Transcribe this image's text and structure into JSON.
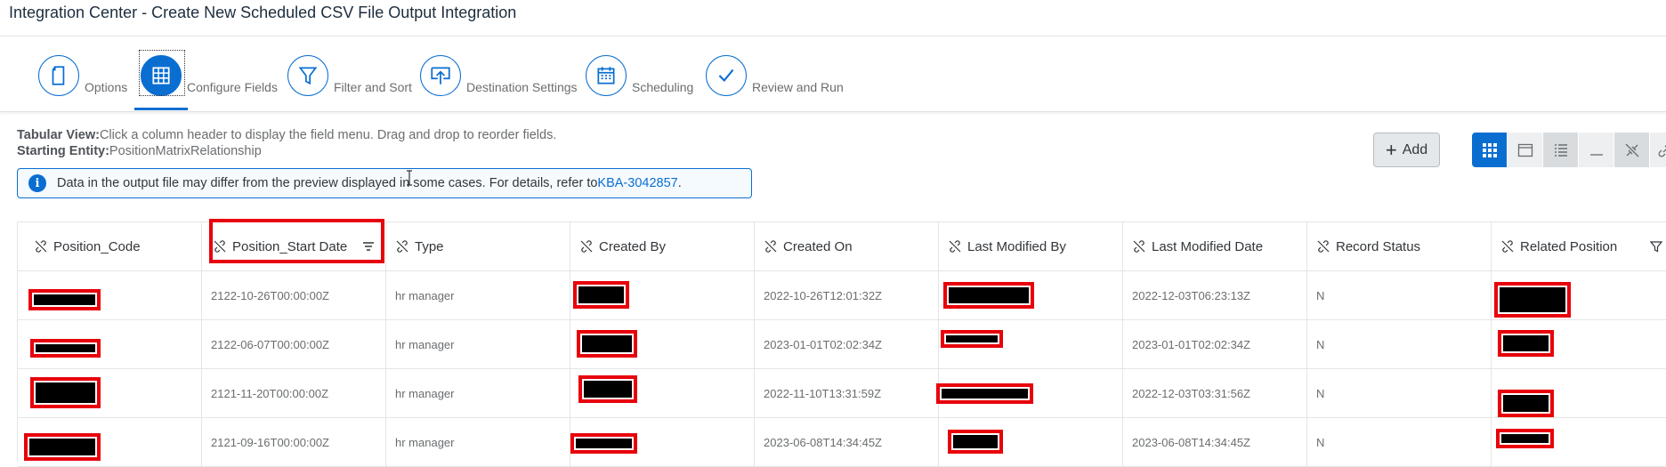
{
  "title": "Integration Center - Create New Scheduled CSV File Output Integration",
  "wizard": {
    "steps": [
      {
        "label": "Options",
        "icon": "document-icon"
      },
      {
        "label": "Configure Fields",
        "icon": "table-icon"
      },
      {
        "label": "Filter and Sort",
        "icon": "filter-icon"
      },
      {
        "label": "Destination Settings",
        "icon": "upload-icon"
      },
      {
        "label": "Scheduling",
        "icon": "calendar-icon"
      },
      {
        "label": "Review and Run",
        "icon": "checkmark-icon"
      }
    ],
    "active_step": "Configure Fields"
  },
  "info": {
    "view_label": "Tabular View:",
    "view_text": "Click a column header to display the field menu. Drag and drop to reorder fields.",
    "entity_label": "Starting Entity:",
    "entity_value": "PositionMatrixRelationship"
  },
  "message": {
    "text": "Data in the output file may differ from the preview displayed in some cases. For details, refer to ",
    "link": "KBA-3042857",
    "suffix": "."
  },
  "toolbar": {
    "add_label": "Add"
  },
  "table": {
    "columns": [
      "Position_Code",
      "Position_Start Date",
      "Type",
      "Created By",
      "Created On",
      "Last Modified By",
      "Last Modified Date",
      "Record Status",
      "Related Position"
    ],
    "rows": [
      {
        "start": "2122-10-26T00:00:00Z",
        "type": "hr manager",
        "created_on": "2022-10-26T12:01:32Z",
        "mod_date": "2022-12-03T06:23:13Z",
        "status": "N"
      },
      {
        "start": "2122-06-07T00:00:00Z",
        "type": "hr manager",
        "created_on": "2023-01-01T02:02:34Z",
        "mod_date": "2023-01-01T02:02:34Z",
        "status": "N"
      },
      {
        "start": "2121-11-20T00:00:00Z",
        "type": "hr manager",
        "created_on": "2022-11-10T13:31:59Z",
        "mod_date": "2022-12-03T03:31:56Z",
        "status": "N"
      },
      {
        "start": "2121-09-16T00:00:00Z",
        "type": "hr manager",
        "created_on": "2023-06-08T14:34:45Z",
        "mod_date": "2023-06-08T14:34:45Z",
        "status": "N"
      }
    ]
  },
  "colors": {
    "accent": "#0a6ed1",
    "highlight": "#e8000b",
    "redaction": "#000000"
  }
}
